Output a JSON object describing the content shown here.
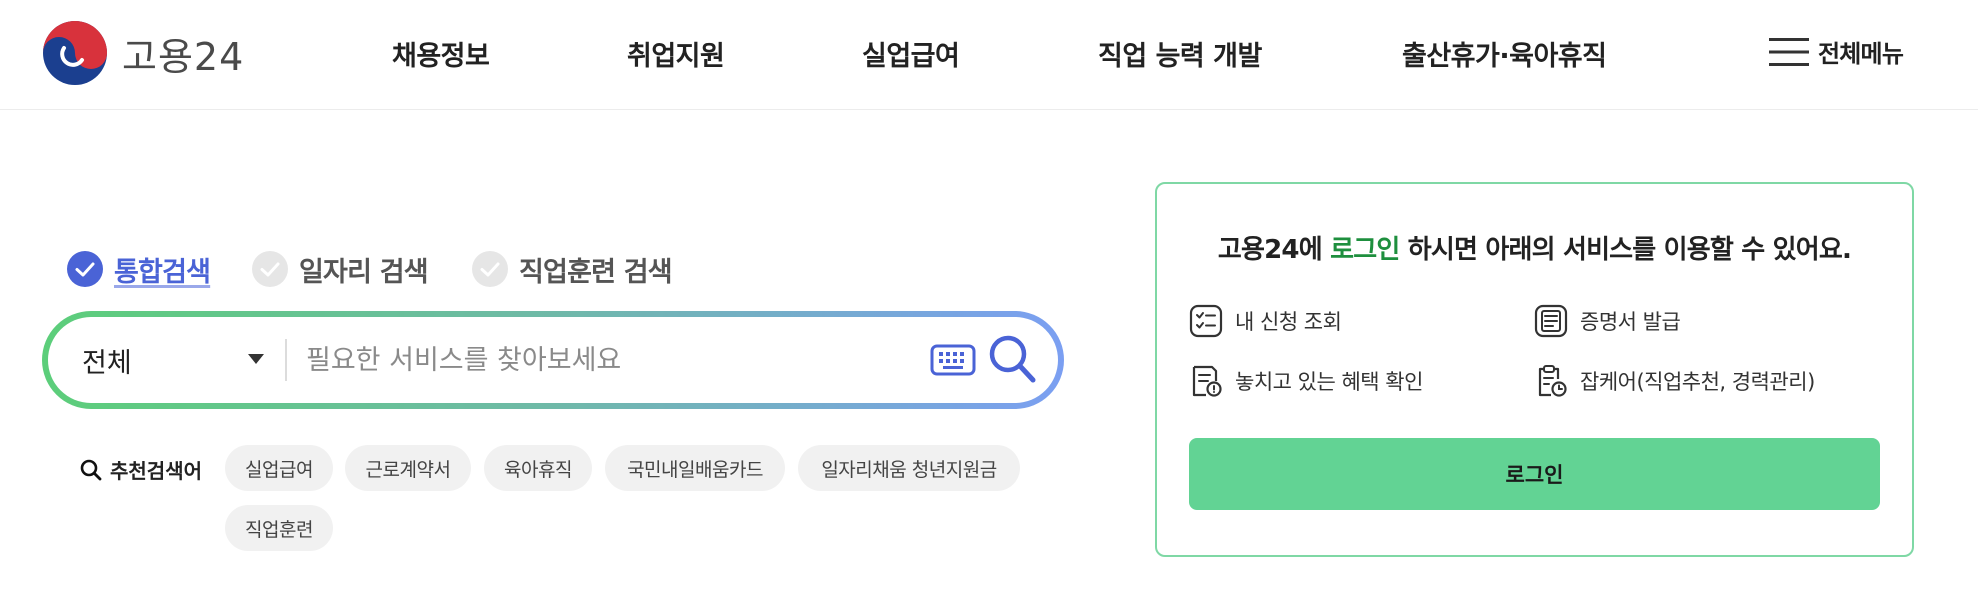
{
  "header": {
    "logo_text": "고용24",
    "nav": [
      "채용정보",
      "취업지원",
      "실업급여",
      "직업 능력 개발",
      "출산휴가·육아휴직"
    ],
    "all_menu_label": "전체메뉴"
  },
  "search": {
    "tabs": [
      {
        "label": "통합검색",
        "active": true
      },
      {
        "label": "일자리 검색",
        "active": false
      },
      {
        "label": "직업훈련 검색",
        "active": false
      }
    ],
    "scope_selected": "전체",
    "placeholder": "필요한 서비스를 찾아보세요",
    "value": ""
  },
  "recommended": {
    "label": "추천검색어",
    "chips": [
      "실업급여",
      "근로계약서",
      "육아휴직",
      "국민내일배움카드",
      "일자리채움 청년지원금",
      "직업훈련"
    ]
  },
  "login_panel": {
    "title_prefix": "고용24에 ",
    "title_accent": "로그인",
    "title_suffix": " 하시면 아래의 서비스를 이용할 수 있어요.",
    "services": [
      "내 신청 조회",
      "증명서 발급",
      "놓치고 있는 혜택 확인",
      "잡케어(직업추천, 경력관리)"
    ],
    "button_label": "로그인"
  },
  "colors": {
    "brand_green": "#62d394",
    "accent_green_text": "#1e8f3e",
    "active_tab_blue": "#4a63d6",
    "panel_border": "#7fd8a5"
  },
  "icons": {
    "logo": "taegeuk-logo-icon",
    "all_menu": "hamburger-icon",
    "tab_check": "check-circle-icon",
    "keyboard": "keyboard-icon",
    "search": "search-icon",
    "services": [
      "checklist-icon",
      "certificate-icon",
      "document-alert-icon",
      "clipboard-clock-icon"
    ]
  }
}
